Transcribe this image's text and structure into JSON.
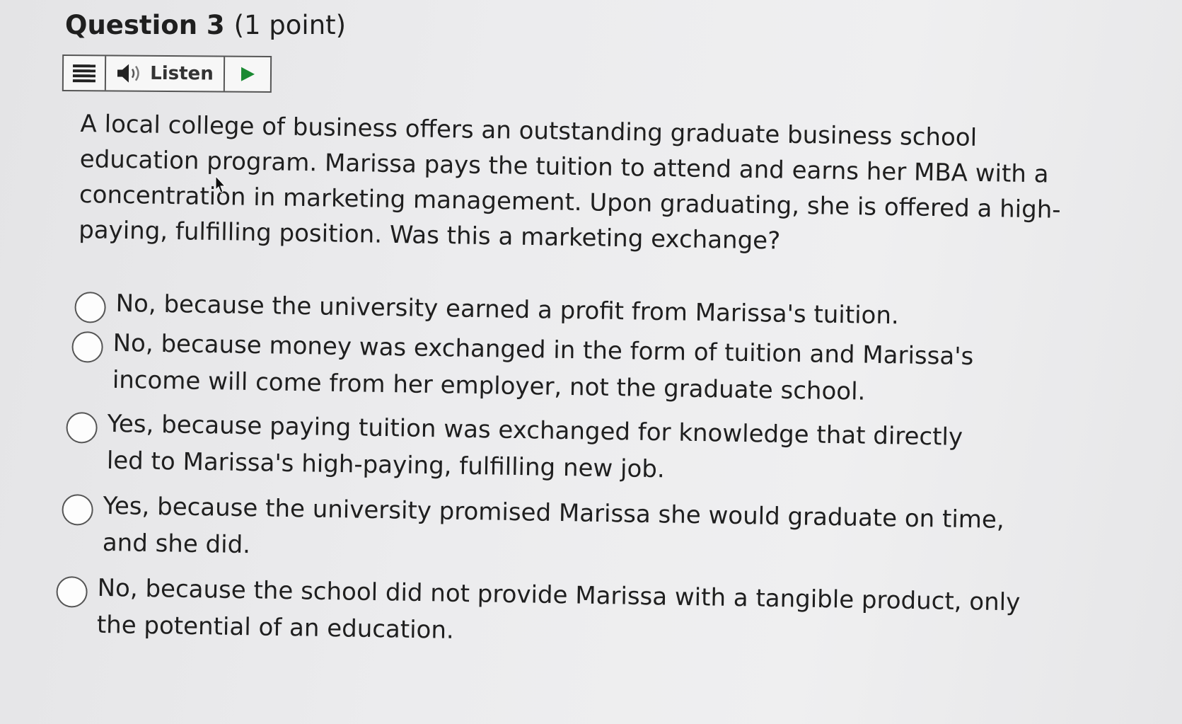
{
  "question": {
    "label": "Question 3",
    "points": "(1 point)",
    "text": "A local college of business offers an outstanding graduate business school education program. Marissa pays the tuition to attend and earns her MBA with a concentration in marketing management. Upon graduating, she is offered a high-paying, fulfilling position. Was this a marketing exchange?"
  },
  "toolbar": {
    "menu_icon": "menu-lines-icon",
    "listen_label": "Listen",
    "speaker_icon": "speaker-icon",
    "play_icon": "play-icon"
  },
  "options": [
    {
      "label": "No, because the university earned a profit from Marissa's tuition."
    },
    {
      "label": "No, because money was exchanged in the form of tuition and Marissa's income will come from her employer, not the graduate school."
    },
    {
      "label": "Yes, because paying tuition was exchanged for knowledge that directly led to Marissa's high-paying, fulfilling new job."
    },
    {
      "label": "Yes, because the university promised Marissa she would graduate on time, and she did."
    },
    {
      "label": "No, because the school did not provide Marissa with a tangible product, only the potential of an education."
    }
  ],
  "colors": {
    "accent": "#1a8a32",
    "text": "#1f1f1f",
    "border": "#555555"
  }
}
